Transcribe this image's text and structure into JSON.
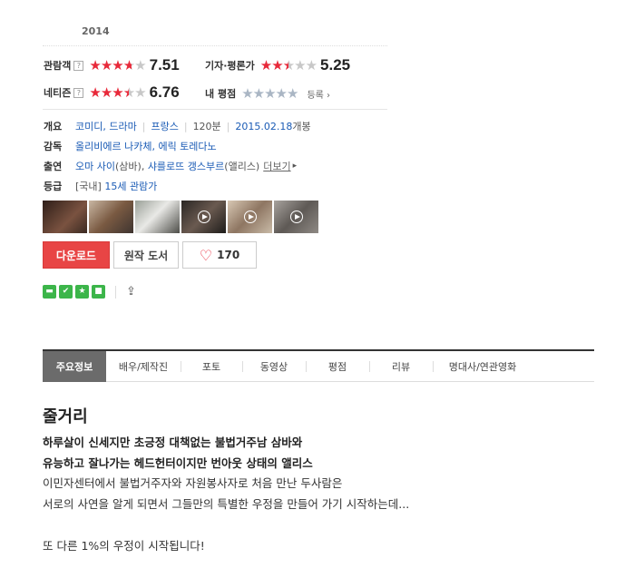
{
  "movie": {
    "year": "2014"
  },
  "ratings": {
    "audience": {
      "label": "관람객",
      "score": "7.51",
      "stars": 3.75
    },
    "critics": {
      "label": "기자·평론가",
      "score": "5.25",
      "stars": 2.5
    },
    "netizen": {
      "label": "네티즌",
      "score": "6.76",
      "stars": 3.5
    },
    "my": {
      "label": "내 평점",
      "register": "등록"
    },
    "info_mark": "?"
  },
  "info": {
    "overview_label": "개요",
    "genres": [
      "코미디",
      "드라마"
    ],
    "country": "프랑스",
    "runtime": "120분",
    "release_date": "2015.02.18",
    "release_suffix": "개봉",
    "director_label": "감독",
    "directors": "올리비에르 나카체, 에릭 토레다노",
    "cast_label": "출연",
    "cast1": "오마 사이",
    "cast1_role": "(삼바)",
    "cast2": "샤를로뜨 갱스부르",
    "cast2_role": "(앨리스)",
    "more": "더보기",
    "grade_label": "등급",
    "grade_region": "[국내]",
    "grade": "15세 관람가"
  },
  "thumbnails": [
    {
      "color": "#5a3b2e",
      "video": false
    },
    {
      "color": "#8a6a52",
      "video": false
    },
    {
      "color": "#6f7268",
      "video": false
    },
    {
      "color": "#3d3a37",
      "video": true
    },
    {
      "color": "#b09a86",
      "video": true
    },
    {
      "color": "#7d7873",
      "video": true
    }
  ],
  "buttons": {
    "download": "다운로드",
    "book": "원작 도서",
    "like_count": "170"
  },
  "social": [
    "twitter-icon",
    "facebook-icon",
    "star-icon",
    "green-icon"
  ],
  "tabs": [
    "주요정보",
    "배우/제작진",
    "포토",
    "동영상",
    "평점",
    "리뷰",
    "명대사/연관영화"
  ],
  "story": {
    "title": "줄거리",
    "line1": "하루살이 신세지만 초긍정 대책없는 불법거주남 삼바와",
    "line2": "유능하고 잘나가는 헤드헌터이지만 번아웃 상태의 앨리스",
    "line3": "이민자센터에서 불법거주자와 자원봉사자로 처음 만난 두사람은",
    "line4": " 서로의 사연을 알게 되면서 그들만의 특별한 우정을 만들어 가기 시작하는데...",
    "line5": " 또 다른 1%의 우정이 시작됩니다!"
  },
  "colors": {
    "accent_red": "#e84545",
    "link_blue": "#1a5bb5",
    "star_red": "#e8293a"
  }
}
